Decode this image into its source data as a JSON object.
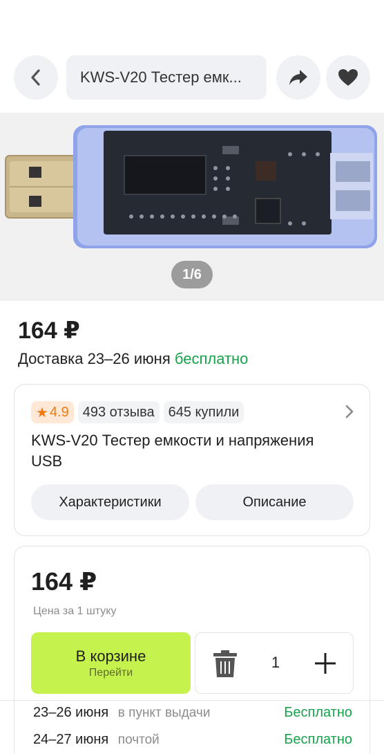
{
  "header": {
    "search_text": "KWS-V20 Тестер емк..."
  },
  "gallery": {
    "counter": "1/6"
  },
  "product": {
    "price": "164 ₽",
    "delivery_prefix": "Доставка 23–26 июня",
    "delivery_free": "бесплатно",
    "rating": "4.9",
    "reviews": "493 отзыва",
    "bought": "645 купили",
    "title": "KWS-V20 Тестер емкости и напряжения USB",
    "tab_specs": "Характеристики",
    "tab_desc": "Описание"
  },
  "purchase": {
    "price": "164 ₽",
    "per_unit": "Цена за 1 штуку",
    "cart_label": "В корзине",
    "cart_sub": "Перейти",
    "quantity": "1"
  },
  "delivery_options": [
    {
      "date": "23–26 июня",
      "method": "в пункт выдачи",
      "cost": "Бесплатно"
    },
    {
      "date": "24–27 июня",
      "method": "почтой",
      "cost": "Бесплатно"
    }
  ],
  "colors": {
    "accent_green": "#17a34a",
    "cart_button": "#c6f24e",
    "rating_orange": "#f07a10"
  }
}
